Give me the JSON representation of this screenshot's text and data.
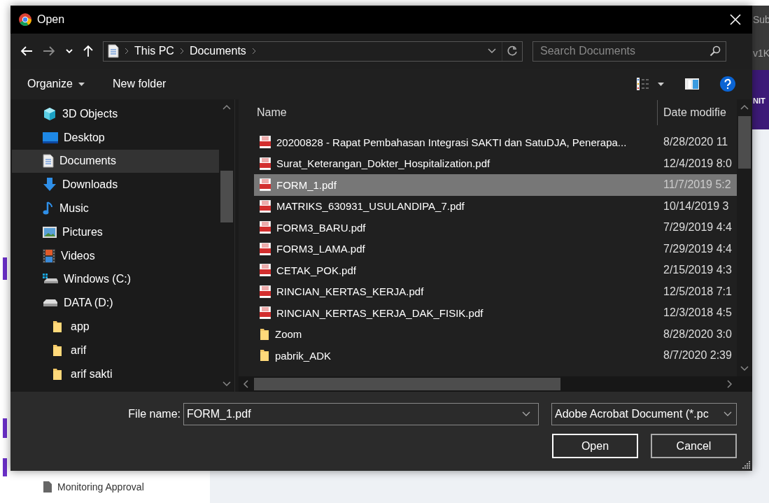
{
  "background": {
    "header_fragments": [
      "Sub",
      "v1K",
      "NIT"
    ],
    "sidebar_link": "Monitoring Approval"
  },
  "dialog": {
    "title": "Open",
    "address": {
      "crumbs": [
        "This PC",
        "Documents"
      ]
    },
    "search": {
      "placeholder": "Search Documents"
    },
    "toolbar": {
      "organize": "Organize",
      "new_folder": "New folder"
    },
    "nav": [
      {
        "label": "3D Objects",
        "kind": "objects3d",
        "selected": false
      },
      {
        "label": "Desktop",
        "kind": "desktop",
        "selected": false
      },
      {
        "label": "Documents",
        "kind": "documents",
        "selected": true
      },
      {
        "label": "Downloads",
        "kind": "downloads",
        "selected": false
      },
      {
        "label": "Music",
        "kind": "music",
        "selected": false
      },
      {
        "label": "Pictures",
        "kind": "pictures",
        "selected": false
      },
      {
        "label": "Videos",
        "kind": "videos",
        "selected": false
      },
      {
        "label": "Windows (C:)",
        "kind": "system-drive",
        "selected": false
      },
      {
        "label": "DATA (D:)",
        "kind": "drive",
        "selected": false,
        "children": [
          {
            "label": "app",
            "kind": "folder",
            "selected": false
          },
          {
            "label": "arif",
            "kind": "folder",
            "selected": false
          },
          {
            "label": "arif sakti",
            "kind": "folder",
            "selected": false
          }
        ]
      }
    ],
    "columns": [
      "Name",
      "Date modifie"
    ],
    "files": [
      {
        "name": "20200828 - Rapat Pembahasan Integrasi SAKTI dan SatuDJA, Penerapa...",
        "date": "8/28/2020 11",
        "kind": "pdf",
        "selected": false
      },
      {
        "name": "Surat_Keterangan_Dokter_Hospitalization.pdf",
        "date": "12/4/2019 8:0",
        "kind": "pdf",
        "selected": false
      },
      {
        "name": "FORM_1.pdf",
        "date": "11/7/2019 5:2",
        "kind": "pdf",
        "selected": true
      },
      {
        "name": "MATRIKS_630931_USULANDIPA_7.pdf",
        "date": "10/14/2019 3",
        "kind": "pdf",
        "selected": false
      },
      {
        "name": "FORM3_BARU.pdf",
        "date": "7/29/2019 4:4",
        "kind": "pdf",
        "selected": false
      },
      {
        "name": "FORM3_LAMA.pdf",
        "date": "7/29/2019 4:4",
        "kind": "pdf",
        "selected": false
      },
      {
        "name": "CETAK_POK.pdf",
        "date": "2/15/2019 4:3",
        "kind": "pdf",
        "selected": false
      },
      {
        "name": "RINCIAN_KERTAS_KERJA.pdf",
        "date": "12/5/2018 7:1",
        "kind": "pdf",
        "selected": false
      },
      {
        "name": "RINCIAN_KERTAS_KERJA_DAK_FISIK.pdf",
        "date": "12/3/2018 4:5",
        "kind": "pdf",
        "selected": false
      },
      {
        "name": "Zoom",
        "date": "8/28/2020 3:0",
        "kind": "folder",
        "selected": false
      },
      {
        "name": "pabrik_ADK",
        "date": "8/7/2020 2:39",
        "kind": "folder",
        "selected": false
      }
    ],
    "file_name": {
      "label": "File name:",
      "value": "FORM_1.pdf"
    },
    "file_type": "Adobe Acrobat Document (*.pc",
    "buttons": [
      {
        "label": "Open",
        "default": true
      },
      {
        "label": "Cancel",
        "default": false
      }
    ]
  }
}
